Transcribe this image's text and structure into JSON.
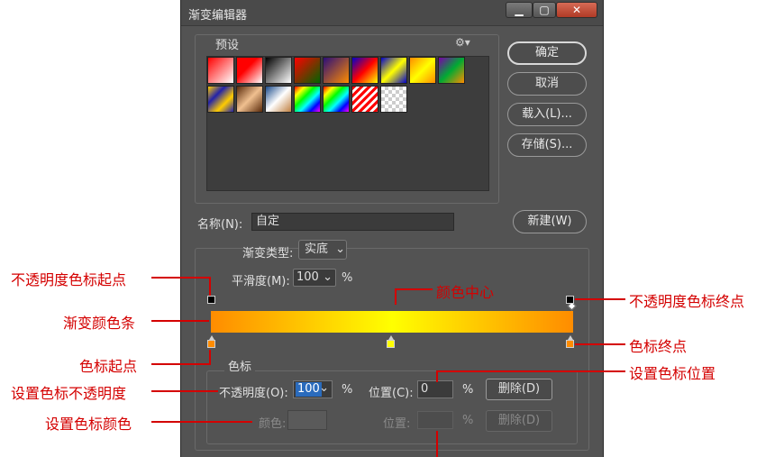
{
  "dialog": {
    "title": "渐变编辑器",
    "window_buttons": {
      "minimize": "▁",
      "maximize": "▢",
      "close": "✕"
    }
  },
  "presets": {
    "label": "预设",
    "gear_icon": "⚙▾",
    "swatches": [
      {
        "bg": "linear-gradient(135deg,#ff0000,#ffffff)"
      },
      {
        "bg": "linear-gradient(135deg,#ff0000 0%,#ff0000 40%,#ffffff 100%)"
      },
      {
        "bg": "linear-gradient(135deg,#000000,#ffffff)"
      },
      {
        "bg": "linear-gradient(135deg,#ff0000,#006400)"
      },
      {
        "bg": "linear-gradient(135deg,#2b0e7a,#ff8c00)"
      },
      {
        "bg": "linear-gradient(135deg,#0000cc,#ff0000,#ffff00)"
      },
      {
        "bg": "linear-gradient(135deg,#0000cc,#ffff00,#0000cc)"
      },
      {
        "bg": "linear-gradient(135deg,#ff8c00,#ffff00,#ff8c00)"
      },
      {
        "bg": "linear-gradient(135deg,#7a00aa,#00aa33,#ff8c00)"
      },
      {
        "bg": "linear-gradient(135deg,#ffcc00,#2222aa,#ffcc00,#2222aa)"
      },
      {
        "bg": "linear-gradient(135deg,#5a2a0a,#f0c090,#5a2a0a)"
      },
      {
        "bg": "linear-gradient(135deg,#1a4a8a,#ffffff,#c08040)"
      },
      {
        "bg": "linear-gradient(135deg,#ff0000,#ffff00,#00ff00,#00ffff,#0000ff,#ff00ff)"
      },
      {
        "bg": "linear-gradient(135deg,#ff0000,#ffff00,#00ff00,#00ffff,#0000ff,#ff00ff)"
      },
      {
        "bg": "repeating-linear-gradient(135deg,#ff0000 0 3px,#ffffff 3px 6px)"
      },
      {
        "bg": "repeating-conic-gradient(#cccccc 0 25%,#ffffff 0 50%) 0 0/8px 8px"
      }
    ]
  },
  "buttons": {
    "ok": "确定",
    "cancel": "取消",
    "load": "载入(L)...",
    "save": "存储(S)...",
    "new": "新建(W)"
  },
  "name": {
    "label": "名称(N):",
    "value": "自定"
  },
  "gradient": {
    "type_label": "渐变类型:",
    "type_value": "实底",
    "smoothness_label": "平滑度(M):",
    "smoothness_value": "100",
    "smoothness_unit": "%",
    "dropdown_glyph": "⌄",
    "colors": {
      "start": "#ff8c00",
      "mid": "#ffff00",
      "end": "#ff8c00"
    }
  },
  "stops": {
    "section_label": "色标",
    "opacity_label": "不透明度(O):",
    "opacity_value": "100",
    "opacity_unit": "%",
    "position_label": "位置(C):",
    "position_value": "0",
    "position_unit": "%",
    "delete_label": "删除(D)",
    "color_label": "颜色:",
    "position2_label": "位置:",
    "position2_unit": "%",
    "delete2_label": "删除(D)"
  },
  "annotations": {
    "opacity_start": "不透明度色标起点",
    "gradient_bar": "渐变颜色条",
    "color_start": "色标起点",
    "set_opacity": "设置色标不透明度",
    "set_color": "设置色标颜色",
    "color_center": "颜色中心",
    "opacity_end": "不透明度色标终点",
    "color_end": "色标终点",
    "set_position": "设置色标位置"
  }
}
